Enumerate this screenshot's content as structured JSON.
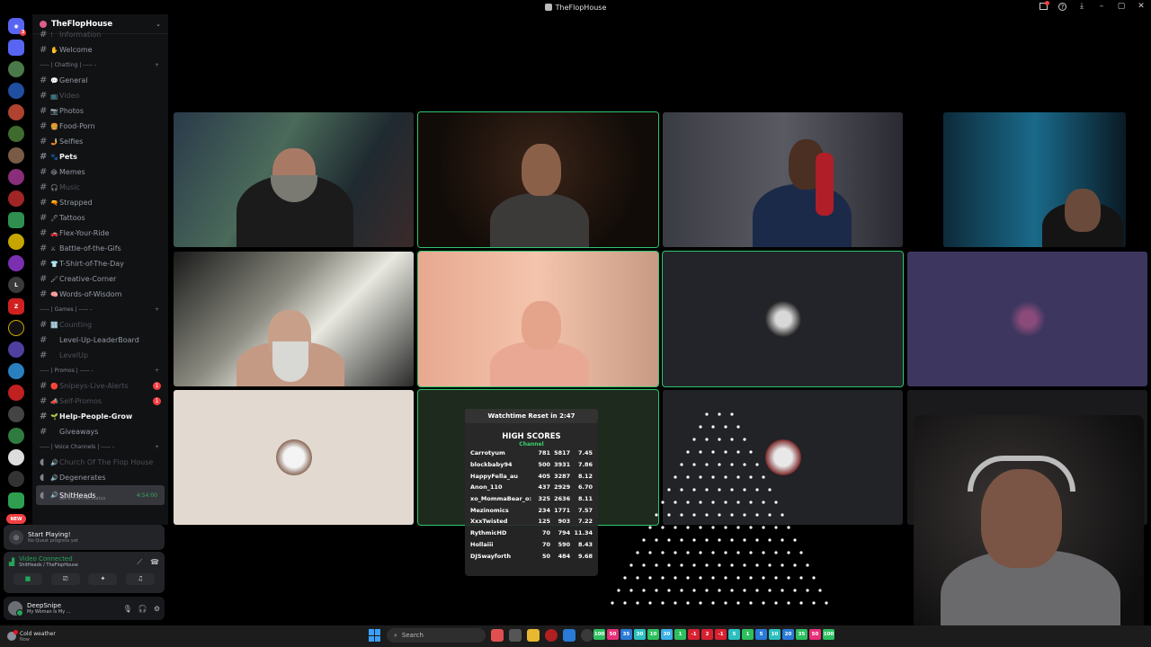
{
  "window": {
    "title": "TheFlopHouse"
  },
  "server": {
    "name": "TheFlopHouse"
  },
  "channels": [
    {
      "type": "chan",
      "label": "Information",
      "emoji": "!",
      "style": "muted"
    },
    {
      "type": "chan",
      "label": "Welcome",
      "emoji": "✋",
      "style": ""
    },
    {
      "type": "cat",
      "label": "----- | Chatting | ----- -"
    },
    {
      "type": "chan",
      "label": "General",
      "emoji": "💬",
      "style": ""
    },
    {
      "type": "chan",
      "label": "Video",
      "emoji": "📺",
      "style": "muted"
    },
    {
      "type": "chan",
      "label": "Photos",
      "emoji": "📷",
      "style": ""
    },
    {
      "type": "chan",
      "label": "Food-Porn",
      "emoji": "🍔",
      "style": ""
    },
    {
      "type": "chan",
      "label": "Selfies",
      "emoji": "🤳",
      "style": ""
    },
    {
      "type": "chan",
      "label": "Pets",
      "emoji": "🐾",
      "style": "active"
    },
    {
      "type": "chan",
      "label": "Memes",
      "emoji": "😂",
      "style": ""
    },
    {
      "type": "chan",
      "label": "Music",
      "emoji": "🎧",
      "style": "muted"
    },
    {
      "type": "chan",
      "label": "Strapped",
      "emoji": "🔫",
      "style": ""
    },
    {
      "type": "chan",
      "label": "Tattoos",
      "emoji": "🖊",
      "style": ""
    },
    {
      "type": "chan",
      "label": "Flex-Your-Ride",
      "emoji": "🚗",
      "style": ""
    },
    {
      "type": "chan",
      "label": "Battle-of-the-Gifs",
      "emoji": "⚔",
      "style": ""
    },
    {
      "type": "chan",
      "label": "T-Shirt-of-The-Day",
      "emoji": "👕",
      "style": ""
    },
    {
      "type": "chan",
      "label": "Creative-Corner",
      "emoji": "🖌",
      "style": ""
    },
    {
      "type": "chan",
      "label": "Words-of-Wisdom",
      "emoji": "🧠",
      "style": ""
    },
    {
      "type": "cat",
      "label": "----- | Games | ----- -"
    },
    {
      "type": "chan",
      "label": "Counting",
      "emoji": "🔢",
      "style": "muted"
    },
    {
      "type": "chan",
      "label": "Level-Up-LeaderBoard",
      "emoji": "",
      "style": ""
    },
    {
      "type": "chan",
      "label": "LevelUp",
      "emoji": "",
      "style": "muted"
    },
    {
      "type": "cat",
      "label": "----- | Promos | ----- -"
    },
    {
      "type": "chan",
      "label": "Snipeys-Live-Alerts",
      "emoji": "🔴",
      "style": "muted",
      "badge": "1"
    },
    {
      "type": "chan",
      "label": "Self-Promos",
      "emoji": "📣",
      "style": "muted",
      "badge": "1"
    },
    {
      "type": "chan",
      "label": "Help-People-Grow",
      "emoji": "🌱",
      "style": "active"
    },
    {
      "type": "chan",
      "label": "Giveaways",
      "emoji": "",
      "style": ""
    },
    {
      "type": "cat",
      "label": "----- | Voice Channels | ----- -"
    },
    {
      "type": "voice",
      "label": "Church Of The Flop House",
      "emoji": "🔊",
      "style": "muted"
    },
    {
      "type": "voice",
      "label": "Degenerates",
      "emoji": "🔊",
      "style": ""
    },
    {
      "type": "voice",
      "label": "ShitHeads",
      "emoji": "🔊",
      "style": "sel",
      "time": "4:54:00",
      "sub": "Set a channel status"
    }
  ],
  "quest": {
    "title": "Start Playing!",
    "sub": "No Quest progress yet"
  },
  "voice": {
    "status": "Video Connected",
    "where": "ShitHeads / TheFlopHouse"
  },
  "user": {
    "name": "DeepSnipe",
    "status": "My Woman Is My ..."
  },
  "leaderboard": {
    "timer": "Watchtime Reset in 2:47",
    "heading": "HIGH SCORES",
    "subheading": "Channel",
    "rows": [
      [
        "Carrotyum",
        "781",
        "5817",
        "7.45"
      ],
      [
        "blockbaby94",
        "500",
        "3931",
        "7.86"
      ],
      [
        "HappyFella_au",
        "405",
        "3287",
        "8.12"
      ],
      [
        "Anon_110",
        "437",
        "2929",
        "6.70"
      ],
      [
        "xo_MommaBear_o:",
        "325",
        "2636",
        "8.11"
      ],
      [
        "Mezinomics",
        "234",
        "1771",
        "7.57"
      ],
      [
        "XxxTwisted",
        "125",
        "903",
        "7.22"
      ],
      [
        "RythmicHD",
        "70",
        "794",
        "11.34"
      ],
      [
        "Hollaiii",
        "70",
        "590",
        "8.43"
      ],
      [
        "DJSwayforth",
        "50",
        "484",
        "9.68"
      ]
    ]
  },
  "taskbar": {
    "weather": "Cold weather",
    "weather_sub": "Now",
    "search": "Search",
    "tray": [
      "100",
      "50",
      "35",
      "30",
      "10",
      "30",
      "1",
      "-1",
      "2",
      "-1",
      "5",
      "1",
      "5",
      "10",
      "20",
      "35",
      "50",
      "100"
    ]
  }
}
